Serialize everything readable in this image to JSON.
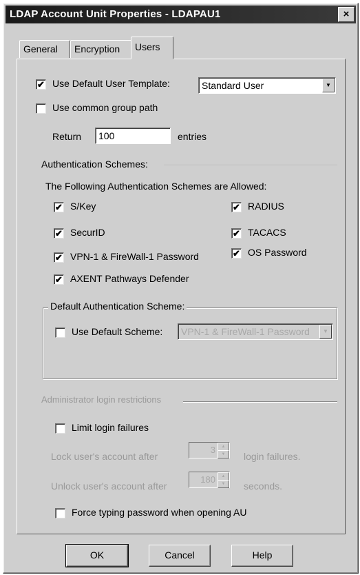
{
  "window": {
    "title": "LDAP Account Unit Properties - LDAPAU1",
    "close_glyph": "×"
  },
  "tabs": [
    {
      "label": "General",
      "active": false
    },
    {
      "label": "Encryption",
      "active": false
    },
    {
      "label": "Users",
      "active": true
    }
  ],
  "users": {
    "use_default_template": {
      "label": "Use Default User Template:",
      "checked": true
    },
    "template_select": {
      "value": "Standard User"
    },
    "use_common_group_path": {
      "label": "Use common group path",
      "checked": false
    },
    "return": {
      "prefix": "Return",
      "value": "100",
      "suffix": "entries"
    }
  },
  "auth": {
    "section_label": "Authentication Schemes:",
    "allowed_label": "The Following Authentication Schemes are Allowed:",
    "schemes": [
      {
        "label": "S/Key",
        "checked": true
      },
      {
        "label": "SecurID",
        "checked": true
      },
      {
        "label": "VPN-1 & FireWall-1 Password",
        "checked": true
      },
      {
        "label": "AXENT Pathways Defender",
        "checked": true
      },
      {
        "label": "RADIUS",
        "checked": true
      },
      {
        "label": "TACACS",
        "checked": true
      },
      {
        "label": "OS Password",
        "checked": true
      }
    ],
    "default_group_label": "Default Authentication Scheme:",
    "use_default_scheme": {
      "label": "Use Default Scheme:",
      "checked": false
    },
    "default_scheme_select": {
      "value": "VPN-1 & FireWall-1 Password"
    }
  },
  "admin": {
    "section_label": "Administrator login restrictions",
    "limit_login_failures": {
      "label": "Limit login failures",
      "checked": false
    },
    "lock_after": {
      "prefix": "Lock user's account after",
      "value": "3",
      "suffix": "login failures."
    },
    "unlock_after": {
      "prefix": "Unlock user's account after",
      "value": "180",
      "suffix": "seconds."
    },
    "force_typing": {
      "label": "Force typing password when opening AU",
      "checked": false
    }
  },
  "buttons": {
    "ok": "OK",
    "cancel": "Cancel",
    "help": "Help"
  },
  "glyphs": {
    "check": "✔",
    "dropdown": "▼",
    "spin_up": "▲",
    "spin_down": "▼"
  }
}
